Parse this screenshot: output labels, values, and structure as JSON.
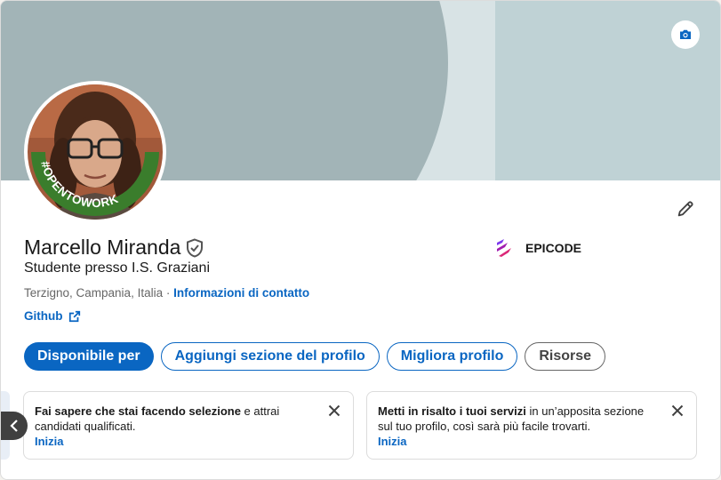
{
  "profile": {
    "name": "Marcello Miranda",
    "headline": "Studente presso I.S. Graziani",
    "location": "Terzigno, Campania, Italia",
    "location_sep": " · ",
    "contact_link": "Informazioni di contatto",
    "github_link": "Github",
    "avatar_badge": "#OPENTOWORK",
    "company": "EPICODE"
  },
  "actions": {
    "open_to": "Disponibile per",
    "add_section": "Aggiungi sezione del profilo",
    "improve": "Migliora profilo",
    "resources": "Risorse"
  },
  "suggestions": [
    {
      "bold": "Fai sapere che stai facendo selezione",
      "text": " e attrai candidati qualificati.",
      "link": "Inizia"
    },
    {
      "bold": "Metti in risalto i tuoi servizi",
      "text": " in un’apposita sezione sul tuo profilo, così sarà più facile trovarti.",
      "link": "Inizia"
    }
  ],
  "colors": {
    "accent": "#0a66c2",
    "banner_light": "#bfd2d5",
    "banner_dark": "#a2b4b7",
    "opentowork_green": "#3a7d2c"
  },
  "icons": {
    "camera": "camera-icon",
    "edit": "pencil-icon",
    "verified": "verified-shield-icon",
    "external": "external-link-icon",
    "close": "close-icon",
    "prev": "chevron-left-icon",
    "company_logo": "epicode-logo"
  }
}
